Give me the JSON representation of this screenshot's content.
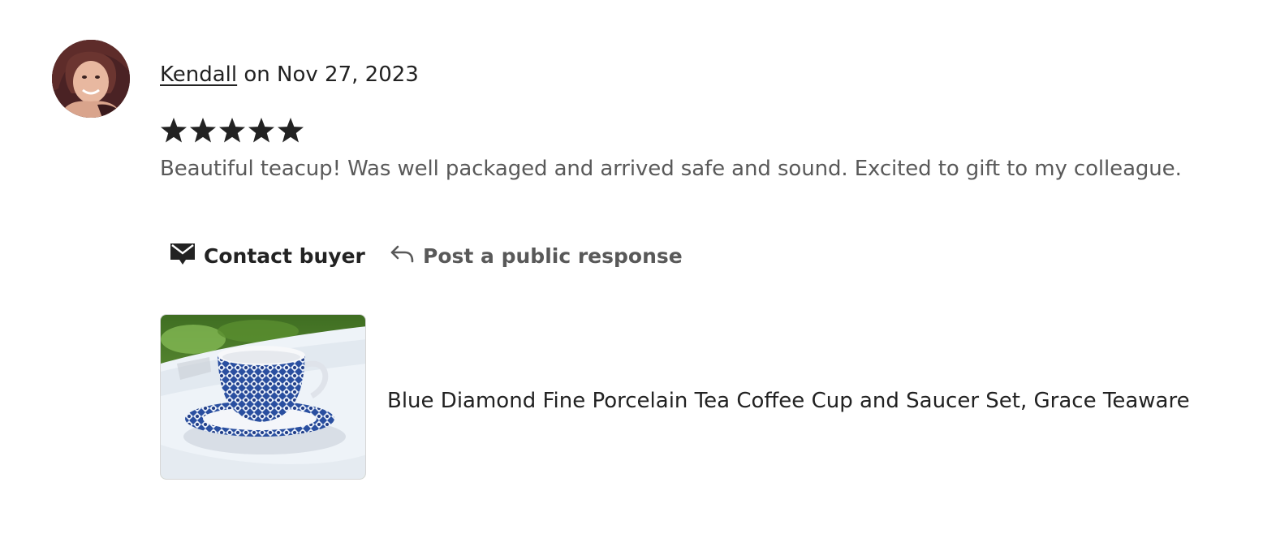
{
  "review": {
    "reviewer_name": "Kendall",
    "date_text": "on Nov 27, 2023",
    "rating": 5,
    "rating_max": 5,
    "text": "Beautiful teacup! Was well packaged and arrived safe and sound. Excited to gift to my colleague."
  },
  "actions": {
    "contact_label": "Contact buyer",
    "respond_label": "Post a public response"
  },
  "listing": {
    "title": "Blue Diamond Fine Porcelain Tea Coffee Cup and Saucer Set, Grace Teaware"
  },
  "icons": {
    "contact": "envelope-icon",
    "respond": "reply-arrow-icon",
    "star": "star-icon"
  },
  "colors": {
    "text_primary": "#222222",
    "text_secondary": "#595959",
    "card_border": "#d6d6d6"
  }
}
